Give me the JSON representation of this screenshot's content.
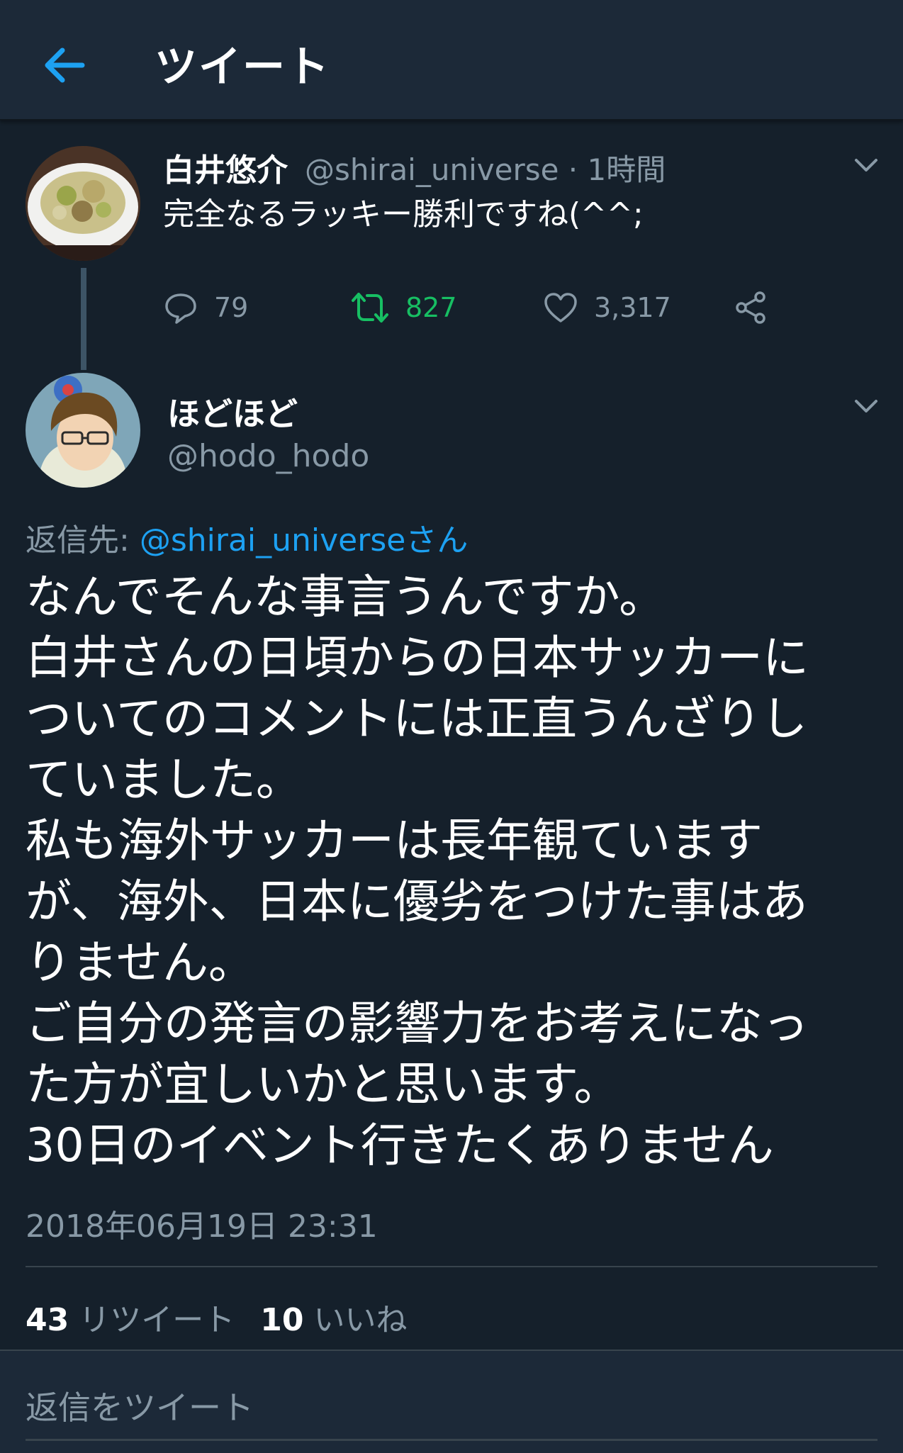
{
  "header": {
    "title": "ツイート",
    "back_icon": "arrow-left-icon",
    "accent_color": "#1da1f2"
  },
  "parent_tweet": {
    "display_name": "白井悠介",
    "handle_time": "@shirai_universe · 1時間",
    "text": "完全なるラッキー勝利ですね(^^;",
    "replies": "79",
    "retweets": "827",
    "likes": "3,317"
  },
  "main_tweet": {
    "display_name": "ほどほど",
    "handle": "@hodo_hodo",
    "reply_to_prefix": "返信先: ",
    "reply_to_mention": "@shirai_universeさん",
    "lines": [
      "なんでそんな事言うんですか。",
      "白井さんの日頃からの日本サッカーに",
      "ついてのコメントには正直うんざりし",
      "ていました。",
      "私も海外サッカーは長年観ています",
      "が、海外、日本に優劣をつけた事はあ",
      "りません。",
      "ご自分の発言の影響力をお考えになっ",
      "た方が宜しいかと思います。",
      "30日のイベント行きたくありません"
    ],
    "timestamp": "2018年06月19日 23:31",
    "retweet_count": "43",
    "retweet_label": "リツイート",
    "like_count": "10",
    "like_label": "いいね"
  },
  "reply_bar": {
    "placeholder": "返信をツイート"
  },
  "colors": {
    "background": "#15202b",
    "header": "#1c2938",
    "secondary_text": "#8899a6",
    "retweet_green": "#17bf63",
    "divider": "#38444d"
  }
}
